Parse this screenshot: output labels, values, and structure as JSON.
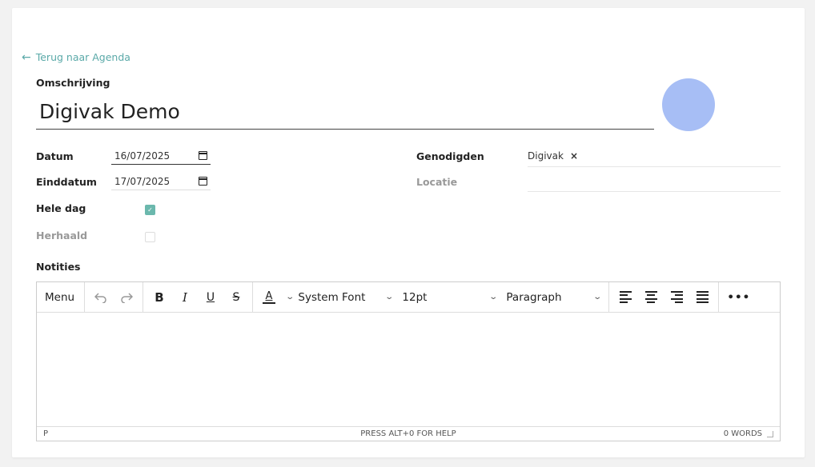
{
  "nav": {
    "back_label": "Terug naar Agenda"
  },
  "form": {
    "description_label": "Omschrijving",
    "title_value": "Digivak Demo",
    "date_label": "Datum",
    "date_value": "16/07/2025",
    "end_date_label": "Einddatum",
    "end_date_value": "17/07/2025",
    "all_day_label": "Hele dag",
    "all_day_checked": true,
    "repeat_label": "Herhaald",
    "repeat_checked": false,
    "invited_label": "Genodigden",
    "invited_chips": [
      "Digivak"
    ],
    "location_label": "Locatie",
    "location_value": "",
    "notes_label": "Notities"
  },
  "editor": {
    "menu_label": "Menu",
    "font_family": "System Font",
    "font_size": "12pt",
    "block_format": "Paragraph",
    "status_path": "P",
    "status_help": "PRESS ALT+0 FOR HELP",
    "status_words": "0 WORDS"
  },
  "colors": {
    "accent": "#5aa9a8",
    "checkbox": "#6bb8ad",
    "avatar": "#a7bef5"
  }
}
